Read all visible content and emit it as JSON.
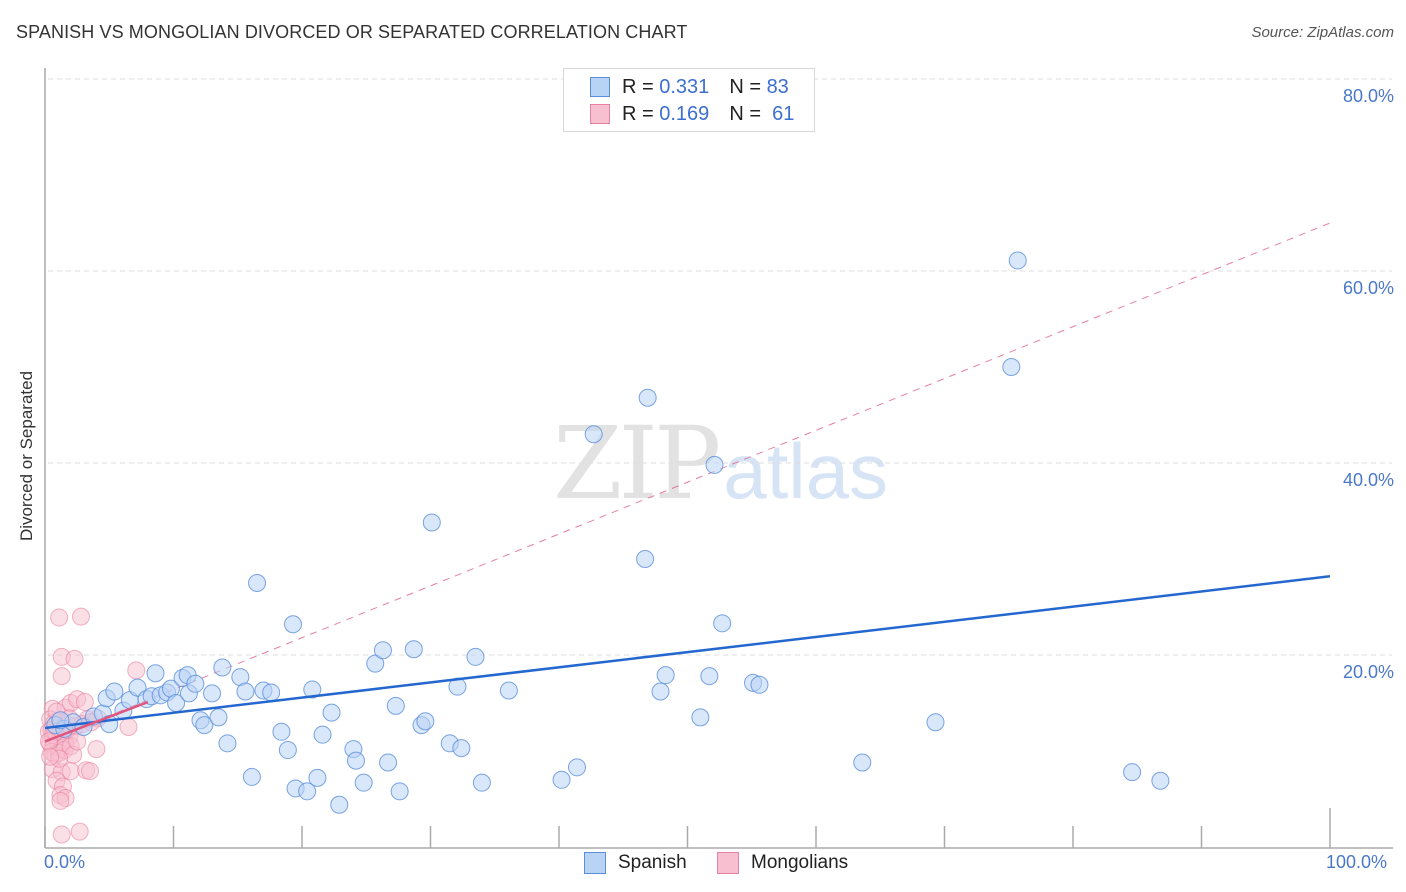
{
  "header": {
    "title": "SPANISH VS MONGOLIAN DIVORCED OR SEPARATED CORRELATION CHART",
    "source": "Source: ZipAtlas.com"
  },
  "watermark": {
    "zip": "ZIP",
    "atlas": "atlas"
  },
  "colors": {
    "spanish_fill": "#b9d3f5",
    "spanish_stroke": "#5b8fd9",
    "spanish_line": "#2468cf",
    "mongolian_fill": "#f7bfd0",
    "mongolian_stroke": "#e8809f",
    "mongolian_line": "#e0567f",
    "tick_label": "#4a78c8",
    "grid": "#dddddd"
  },
  "legend": {
    "rows": [
      {
        "series": "Spanish",
        "r_label": "R = ",
        "r_value": "0.331",
        "n_label": "N = ",
        "n_value": "83"
      },
      {
        "series": "Mongolians",
        "r_label": "R = ",
        "r_value": "0.169",
        "n_label": "N = ",
        "n_value": "61"
      }
    ],
    "bottom": [
      "Spanish",
      "Mongolians"
    ]
  },
  "chart_data": {
    "type": "scatter",
    "title": "SPANISH VS MONGOLIAN DIVORCED OR SEPARATED CORRELATION CHART",
    "xlabel": "",
    "ylabel": "Divorced or Separated",
    "xlim": [
      0,
      100
    ],
    "ylim": [
      0,
      85
    ],
    "x_tick_labels": [
      "0.0%",
      "100.0%"
    ],
    "x_tick_positions": [
      0,
      10,
      20,
      30,
      40,
      50,
      60,
      70,
      80,
      90,
      100
    ],
    "y_ticks": [
      20,
      40,
      60,
      80
    ],
    "y_tick_labels": [
      "20.0%",
      "40.0%",
      "60.0%",
      "80.0%"
    ],
    "grid": "horizontal-dashed",
    "legend_placement": "top-center",
    "series": [
      {
        "name": "Spanish",
        "R": 0.331,
        "N": 83,
        "trend": {
          "x": [
            0,
            100
          ],
          "y": [
            12.4,
            28.2
          ],
          "style": "solid"
        },
        "points": [
          [
            0.8,
            12.7
          ],
          [
            1.5,
            12.3
          ],
          [
            2.2,
            13.0
          ],
          [
            3.0,
            12.5
          ],
          [
            3.8,
            13.6
          ],
          [
            4.5,
            13.9
          ],
          [
            4.8,
            15.5
          ],
          [
            5.4,
            16.2
          ],
          [
            5.0,
            12.8
          ],
          [
            6.1,
            14.2
          ],
          [
            6.6,
            15.3
          ],
          [
            7.2,
            16.6
          ],
          [
            7.9,
            15.4
          ],
          [
            8.3,
            15.7
          ],
          [
            8.6,
            18.1
          ],
          [
            9.0,
            15.8
          ],
          [
            9.5,
            16.1
          ],
          [
            9.8,
            16.5
          ],
          [
            10.2,
            15.0
          ],
          [
            10.7,
            17.6
          ],
          [
            11.1,
            17.9
          ],
          [
            11.2,
            16.0
          ],
          [
            11.7,
            17.0
          ],
          [
            12.1,
            13.2
          ],
          [
            12.4,
            12.7
          ],
          [
            13.0,
            16.0
          ],
          [
            13.5,
            13.5
          ],
          [
            13.8,
            18.7
          ],
          [
            14.2,
            10.8
          ],
          [
            15.2,
            17.7
          ],
          [
            15.6,
            16.2
          ],
          [
            16.1,
            7.3
          ],
          [
            16.5,
            27.5
          ],
          [
            17.0,
            16.3
          ],
          [
            17.6,
            16.1
          ],
          [
            18.4,
            12.0
          ],
          [
            18.9,
            10.1
          ],
          [
            19.3,
            23.2
          ],
          [
            19.5,
            6.1
          ],
          [
            20.4,
            5.8
          ],
          [
            20.8,
            16.4
          ],
          [
            21.2,
            7.2
          ],
          [
            21.6,
            11.7
          ],
          [
            22.3,
            14.0
          ],
          [
            22.9,
            4.4
          ],
          [
            24.0,
            10.2
          ],
          [
            24.2,
            9.0
          ],
          [
            24.8,
            6.7
          ],
          [
            25.7,
            19.1
          ],
          [
            26.3,
            20.5
          ],
          [
            26.7,
            8.8
          ],
          [
            27.3,
            14.7
          ],
          [
            27.6,
            5.8
          ],
          [
            28.7,
            20.6
          ],
          [
            29.3,
            12.7
          ],
          [
            29.6,
            13.1
          ],
          [
            30.1,
            33.8
          ],
          [
            31.5,
            10.8
          ],
          [
            32.1,
            16.7
          ],
          [
            32.4,
            10.3
          ],
          [
            33.5,
            19.8
          ],
          [
            34.0,
            6.7
          ],
          [
            36.1,
            16.3
          ],
          [
            40.2,
            7.0
          ],
          [
            41.4,
            8.3
          ],
          [
            42.7,
            43.0
          ],
          [
            46.7,
            30.0
          ],
          [
            46.9,
            46.8
          ],
          [
            47.9,
            16.2
          ],
          [
            48.3,
            17.9
          ],
          [
            51.0,
            13.5
          ],
          [
            51.7,
            17.8
          ],
          [
            52.1,
            39.8
          ],
          [
            52.7,
            23.3
          ],
          [
            55.1,
            17.1
          ],
          [
            55.6,
            16.9
          ],
          [
            63.6,
            8.8
          ],
          [
            69.3,
            13.0
          ],
          [
            75.2,
            50.0
          ],
          [
            75.7,
            61.1
          ],
          [
            84.6,
            7.8
          ],
          [
            86.8,
            6.9
          ],
          [
            1.2,
            13.2
          ]
        ]
      },
      {
        "name": "Mongolians",
        "R": 0.169,
        "N": 61,
        "trend_solid": {
          "x": [
            0,
            8.0
          ],
          "y": [
            11.0,
            15.1
          ],
          "style": "solid"
        },
        "trend_extended": {
          "x": [
            0,
            100
          ],
          "y": [
            11.0,
            65.0
          ],
          "style": "dashed"
        },
        "points": [
          [
            1.1,
            23.9
          ],
          [
            2.8,
            24.0
          ],
          [
            1.3,
            19.8
          ],
          [
            2.3,
            19.6
          ],
          [
            1.3,
            17.8
          ],
          [
            7.1,
            18.4
          ],
          [
            0.6,
            14.4
          ],
          [
            1.6,
            14.5
          ],
          [
            2.0,
            15.0
          ],
          [
            2.5,
            15.4
          ],
          [
            3.1,
            15.1
          ],
          [
            0.4,
            13.3
          ],
          [
            0.7,
            12.9
          ],
          [
            1.0,
            13.1
          ],
          [
            1.4,
            12.4
          ],
          [
            1.8,
            12.7
          ],
          [
            0.3,
            12.0
          ],
          [
            0.6,
            11.6
          ],
          [
            0.9,
            11.3
          ],
          [
            1.2,
            11.8
          ],
          [
            1.5,
            11.1
          ],
          [
            1.9,
            11.5
          ],
          [
            0.4,
            10.8
          ],
          [
            0.7,
            10.5
          ],
          [
            1.0,
            10.9
          ],
          [
            1.3,
            10.3
          ],
          [
            1.6,
            10.6
          ],
          [
            0.5,
            9.9
          ],
          [
            0.8,
            9.6
          ],
          [
            1.1,
            9.8
          ],
          [
            1.5,
            10.1
          ],
          [
            2.0,
            10.5
          ],
          [
            2.4,
            12.6
          ],
          [
            3.3,
            13.3
          ],
          [
            4.1,
            13.4
          ],
          [
            6.5,
            12.5
          ],
          [
            4.0,
            10.2
          ],
          [
            2.2,
            9.6
          ],
          [
            0.6,
            8.1
          ],
          [
            1.3,
            7.8
          ],
          [
            2.0,
            7.9
          ],
          [
            3.2,
            8.0
          ],
          [
            3.5,
            7.9
          ],
          [
            0.9,
            6.9
          ],
          [
            1.4,
            6.3
          ],
          [
            1.2,
            5.4
          ],
          [
            1.6,
            5.1
          ],
          [
            1.2,
            4.8
          ],
          [
            1.3,
            1.3
          ],
          [
            2.7,
            1.6
          ],
          [
            0.5,
            12.2
          ],
          [
            0.8,
            12.0
          ],
          [
            1.7,
            12.2
          ],
          [
            2.9,
            12.8
          ],
          [
            0.3,
            11.0
          ],
          [
            2.5,
            11.0
          ],
          [
            0.9,
            14.1
          ],
          [
            1.9,
            13.4
          ],
          [
            3.6,
            13.0
          ],
          [
            1.1,
            9.2
          ],
          [
            0.4,
            9.4
          ]
        ]
      }
    ]
  }
}
